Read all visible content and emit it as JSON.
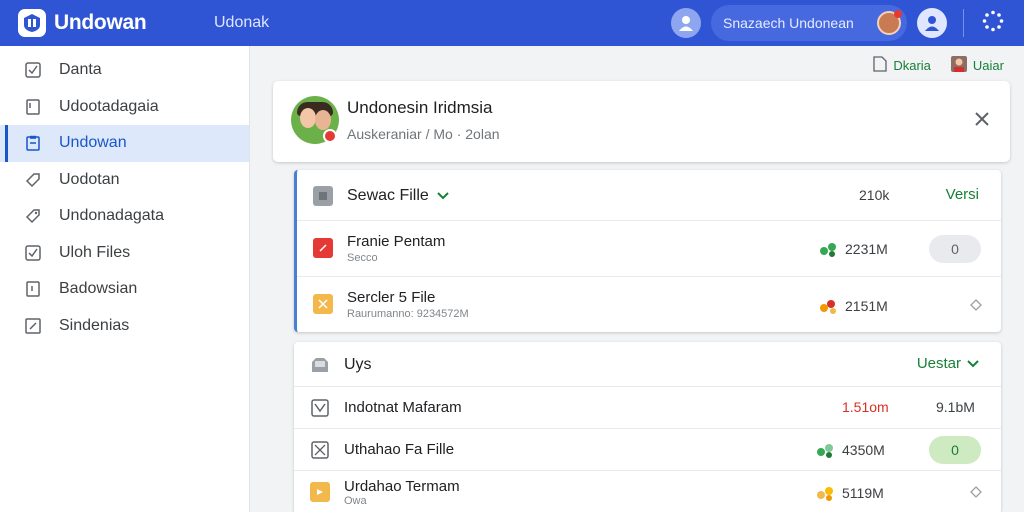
{
  "topbar": {
    "app_name": "Undowan",
    "breadcrumb": "Udonak",
    "search_text": "Snazaech Undonean",
    "brand_color": "#2f55d4"
  },
  "sidebar": {
    "items": [
      {
        "label": "Danta",
        "icon": "checkbox-icon"
      },
      {
        "label": "Udootadagaia",
        "icon": "document-icon"
      },
      {
        "label": "Undowan",
        "icon": "clipboard-icon",
        "active": true
      },
      {
        "label": "Uodotan",
        "icon": "tag-icon"
      },
      {
        "label": "Undonadagata",
        "icon": "tag-icon"
      },
      {
        "label": "Uloh Files",
        "icon": "checkbox-icon"
      },
      {
        "label": "Badowsian",
        "icon": "document-icon"
      },
      {
        "label": "Sindenias",
        "icon": "edit-icon"
      }
    ]
  },
  "actions": {
    "left_label": "Dkaria",
    "right_label": "Uaiar"
  },
  "header": {
    "title": "Undonesin Iridmsia",
    "subtitle": "Auskeraniar / Mo · 2olan"
  },
  "group1": {
    "title": "Sewac Fille",
    "size": "210k",
    "right_label": "Versi",
    "rows": [
      {
        "name": "Franie Pentam",
        "sub": "Secco",
        "size": "2231M",
        "pill": "0",
        "icon_color": "#e53935"
      },
      {
        "name": "Sercler 5 File",
        "sub": "Raurumanno: 9234572M",
        "size": "2151M",
        "icon_color": "#f2b84b"
      }
    ]
  },
  "group2": {
    "title": "Uys",
    "right_label": "Uestar",
    "rows": [
      {
        "name": "Indotnat Mafaram",
        "size_red": "1.51om",
        "size": "9.1bM"
      },
      {
        "name": "Uthahao Fa Fille",
        "size": "4350M",
        "pill": "0"
      },
      {
        "name": "Urdahao Termam",
        "sub": "Owa",
        "size": "5119M",
        "icon_color": "#f2b84b"
      }
    ]
  }
}
